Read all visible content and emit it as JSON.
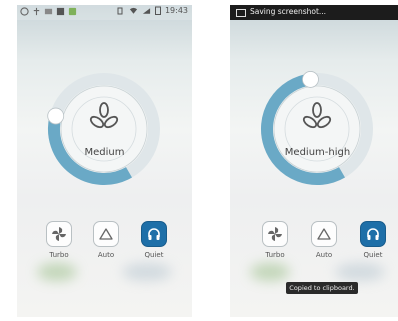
{
  "screen_left": {
    "status_time": "19:43",
    "fan_speed": "Medium",
    "speed_level": 0.5,
    "modes": [
      {
        "label": "Turbo",
        "active": false
      },
      {
        "label": "Auto",
        "active": false
      },
      {
        "label": "Quiet",
        "active": true
      }
    ]
  },
  "screen_right": {
    "notification": "Saving screenshot...",
    "fan_speed": "Medium-high",
    "speed_level": 0.75,
    "modes": [
      {
        "label": "Turbo",
        "active": false
      },
      {
        "label": "Auto",
        "active": false
      },
      {
        "label": "Quiet",
        "active": true
      }
    ],
    "toast": "Copied to clipboard."
  },
  "colors": {
    "ring_fill": "#6aa9c6",
    "ring_track": "#dfe6e9",
    "active_button": "#1e6fa8"
  }
}
